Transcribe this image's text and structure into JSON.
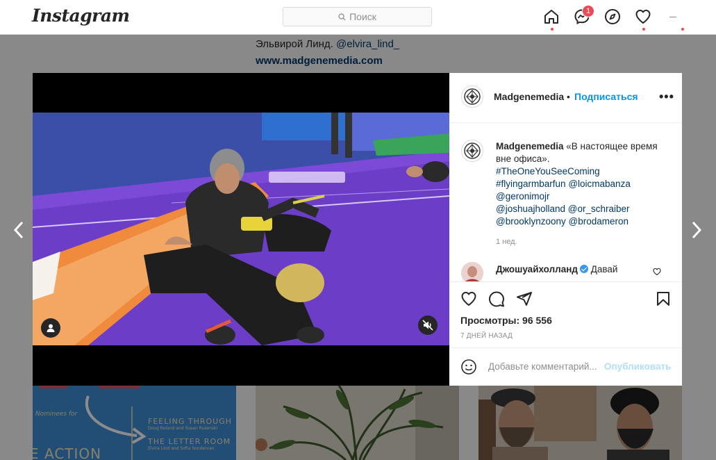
{
  "nav": {
    "logo": "Instagram",
    "search_placeholder": "Поиск",
    "messages_badge": "1",
    "icons": [
      "home-icon",
      "messenger-icon",
      "explore-icon",
      "heart-icon"
    ]
  },
  "background_post": {
    "caption_line1_text": "Эльвирой Линд. ",
    "caption_line1_mention": "@elvira_lind_",
    "caption_line2": "www.madgenemedia.com"
  },
  "thumbnails": {
    "thumb1_lines": [
      "Nominees for",
      "FEELING THROUGH",
      "Doug Roland and Susan Ruzenski",
      "THE LETTER ROOM",
      "Elvira Lind and Sofia Sondervan",
      "E ACTION"
    ]
  },
  "modal": {
    "header": {
      "username": "Madgenemedia",
      "separator": "•",
      "follow_label": "Подписаться",
      "more_label": "•••"
    },
    "caption": {
      "username": "Madgenemedia",
      "text": "«В настоящее время вне офиса».",
      "hashtag1": "#TheOneYouSeeComing",
      "hashtag2": "#flyingarmbarfun",
      "mention1": "@loicmabanza",
      "mention2": "@geronimojr",
      "mention3": "@joshuajholland",
      "mention4": "@or_schraiber",
      "mention5": "@brooklynzoony",
      "mention6": "@brodameron",
      "time": "1 нед."
    },
    "comment": {
      "username": "Джошуайхолланд",
      "text": "Давай"
    },
    "views": "Просмотры: 96 556",
    "date": "7 ДНЕЙ НАЗАД",
    "comment_placeholder": "Добавьте комментарий...",
    "post_label": "Опубликовать"
  },
  "colors": {
    "accent": "#0095f6",
    "link": "#00376b",
    "badge": "#ed4956",
    "mat_purple": "#6c3ec8",
    "mat_orange": "#f08a3c"
  }
}
